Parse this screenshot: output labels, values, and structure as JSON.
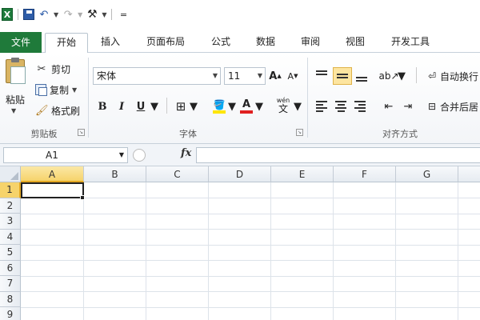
{
  "quick_access": {
    "app_icon_letter": "X",
    "customize_glyph": "="
  },
  "tabs": [
    {
      "label": "文件"
    },
    {
      "label": "开始"
    },
    {
      "label": "插入"
    },
    {
      "label": "页面布局"
    },
    {
      "label": "公式"
    },
    {
      "label": "数据"
    },
    {
      "label": "审阅"
    },
    {
      "label": "视图"
    },
    {
      "label": "开发工具"
    }
  ],
  "clipboard": {
    "paste_label": "粘贴",
    "cut_label": "剪切",
    "copy_label": "复制",
    "format_painter_label": "格式刷",
    "group_label": "剪贴板"
  },
  "font": {
    "font_name": "宋体",
    "font_size": "11",
    "bold": "B",
    "italic": "I",
    "underline": "U",
    "grow": "A",
    "shrink": "A",
    "font_color_letter": "A",
    "phonetic": "wén",
    "phonetic_char": "文",
    "group_label": "字体"
  },
  "alignment": {
    "wrap_text_label": "自动换行",
    "merge_label": "合并后居",
    "group_label": "对齐方式"
  },
  "formula_bar": {
    "name_box": "A1",
    "fx": "fx",
    "formula": ""
  },
  "grid": {
    "columns": [
      "A",
      "B",
      "C",
      "D",
      "E",
      "F",
      "G"
    ],
    "rows": [
      "1",
      "2",
      "3",
      "4",
      "5",
      "6",
      "7",
      "8",
      "9"
    ],
    "active_cell": "A1"
  },
  "colors": {
    "file_tab": "#1f7a3a",
    "selection_header": "#f6d36b",
    "highlight_fill": "#ffe600",
    "font_color": "#e02020"
  }
}
